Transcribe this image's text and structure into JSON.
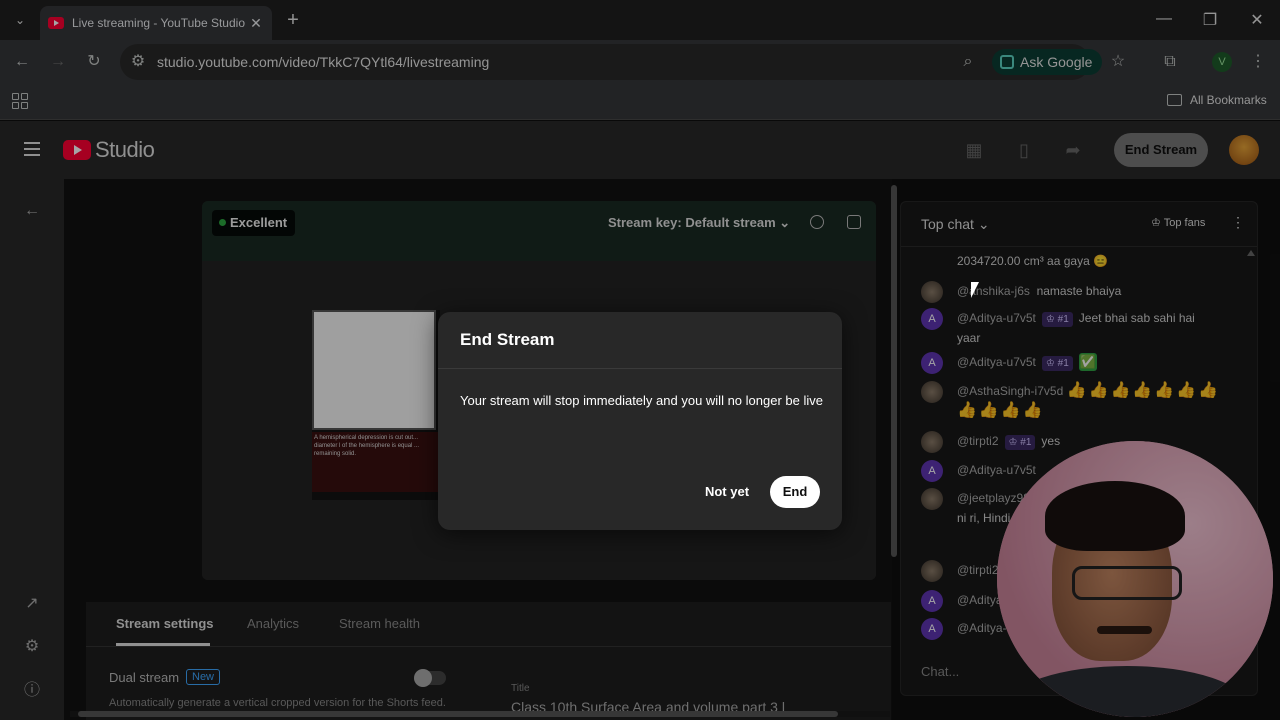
{
  "browser": {
    "tab_title": "Live streaming - YouTube Studio",
    "url": "studio.youtube.com/video/TkkC7QYtl64/livestreaming",
    "ask_google": "Ask Google",
    "all_bookmarks": "All Bookmarks",
    "profile_initial": "V"
  },
  "studio": {
    "logo": "Studio",
    "end_stream": "End Stream"
  },
  "preview": {
    "quality": "Excellent",
    "stream_key": "Stream key: Default stream",
    "inner_text": "A hemispherical depression is cut out... diameter l of the hemisphere is equal ... remaining solid."
  },
  "bottom": {
    "tabs": [
      "Stream settings",
      "Analytics",
      "Stream health"
    ],
    "dual_stream": "Dual stream",
    "new_badge": "New",
    "dual_desc": "Automatically generate a vertical cropped version for the Shorts feed.",
    "title_label": "Title",
    "title_value": "Class 10th Surface Area and volume part 3 l"
  },
  "chat": {
    "header": "Top chat",
    "top_fans": "Top fans",
    "input_placeholder": "Chat...",
    "messages": [
      {
        "avatar": "",
        "author": "",
        "badge": "",
        "text": "2034720.00 cm³ aa gaya 😑"
      },
      {
        "avatar": "",
        "author": "@anshika-j6s",
        "badge": "",
        "text": "namaste bhaiya"
      },
      {
        "avatar": "A",
        "author": "@Aditya-u7v5t",
        "badge": "#1",
        "text": "Jeet bhai sab sahi hai yaar"
      },
      {
        "avatar": "A",
        "author": "@Aditya-u7v5t",
        "badge": "#1",
        "text": "✅"
      },
      {
        "avatar": "",
        "author": "@AsthaSingh-i7v5d",
        "badge": "",
        "text": "👍👍👍👍👍👍👍👍👍👍👍"
      },
      {
        "avatar": "",
        "author": "@tirpti2",
        "badge": "#1",
        "text": "yes"
      },
      {
        "avatar": "A",
        "author": "@Aditya-u7v5t",
        "badge": "",
        "text": ""
      },
      {
        "avatar": "",
        "author": "@jeetplayz98",
        "badge": "",
        "text": "ni ri, Hindi ... Science ... raha hai"
      },
      {
        "avatar": "",
        "author": "@tirpti2",
        "badge": "",
        "text": ""
      },
      {
        "avatar": "A",
        "author": "@Aditya-",
        "badge": "",
        "text": ""
      },
      {
        "avatar": "A",
        "author": "@Aditya-",
        "badge": "",
        "text": ""
      }
    ]
  },
  "dialog": {
    "title": "End Stream",
    "body": "Your stream will stop immediately and you will no longer be live",
    "not_yet": "Not yet",
    "end": "End"
  }
}
